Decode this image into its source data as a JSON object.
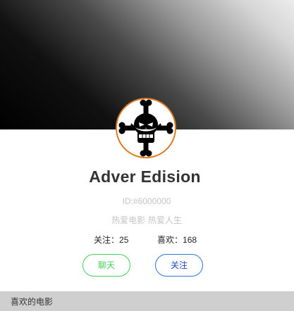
{
  "profile": {
    "avatar_icon": "pirate-skull-avatar-icon",
    "name": "Adver Edision",
    "id_text": "ID:#6000000",
    "motto": "热爱电影 热爱人生"
  },
  "stats": {
    "following_label": "关注：",
    "following_value": "25",
    "likes_label": "喜欢：",
    "likes_value": "168"
  },
  "actions": {
    "chat_label": "聊天",
    "follow_label": "关注"
  },
  "section": {
    "favorites_title": "喜欢的电影"
  },
  "colors": {
    "chat_accent": "#41d157",
    "follow_accent": "#2b74d8",
    "avatar_border": "#e07a1f",
    "section_bar": "#cfcfcf"
  }
}
